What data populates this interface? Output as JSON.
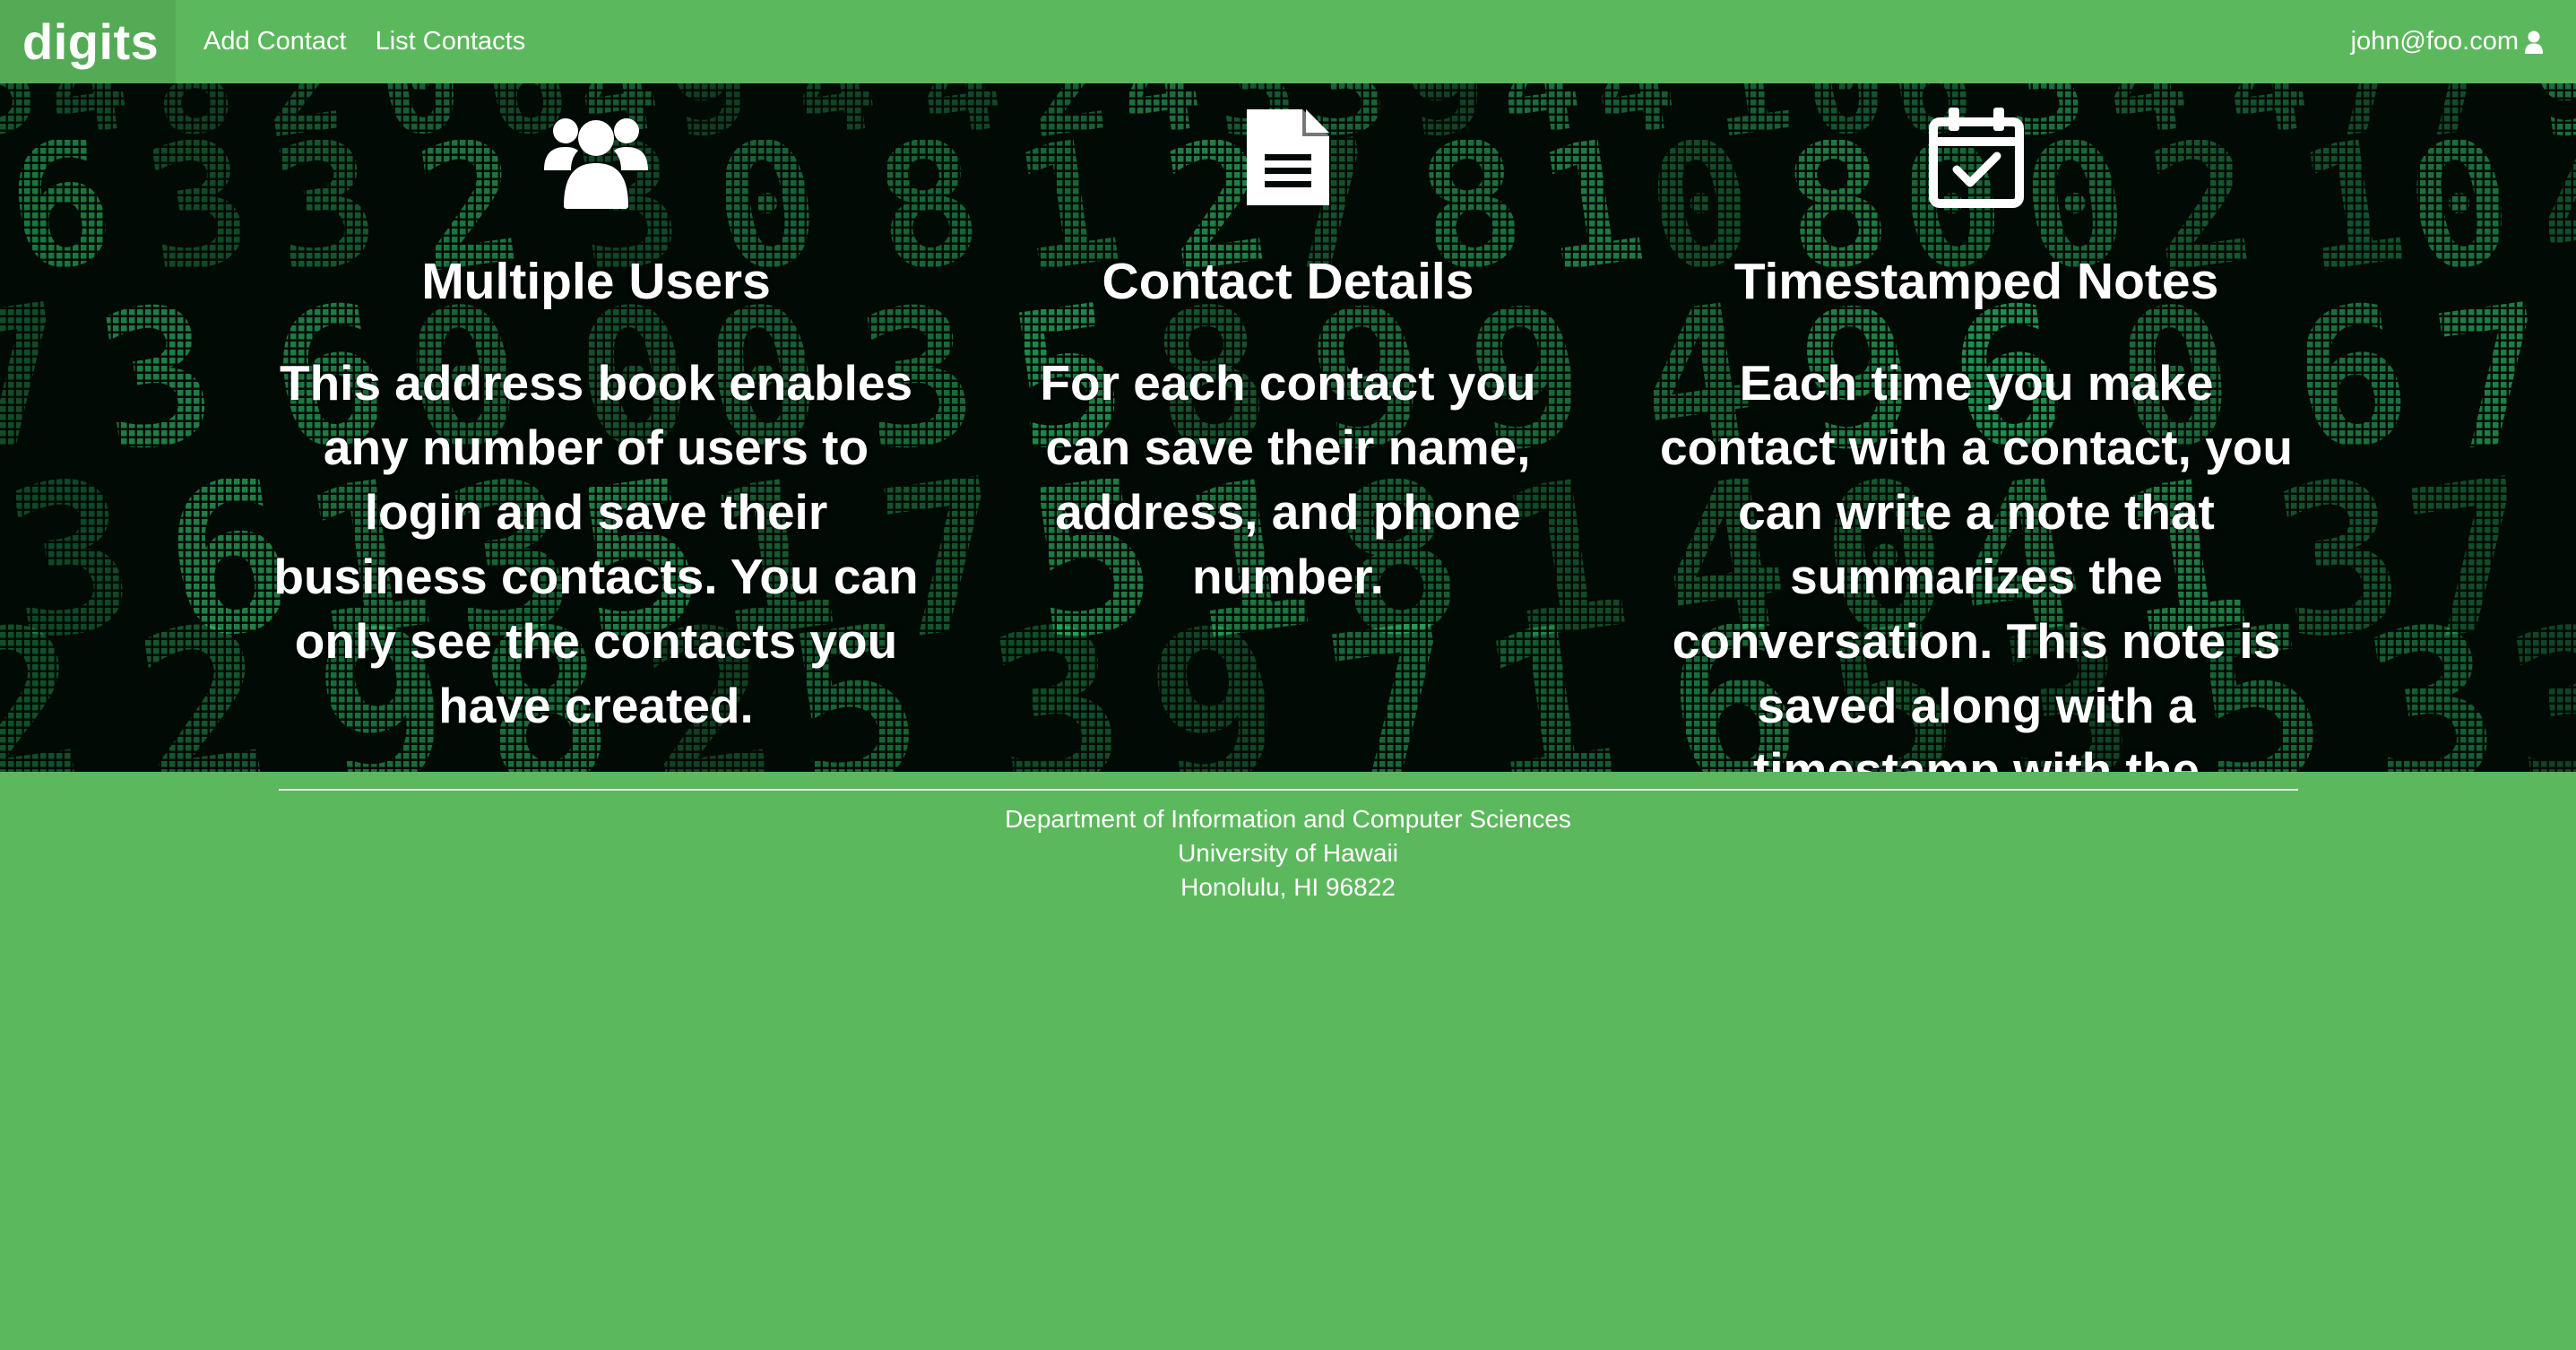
{
  "navbar": {
    "brand": "digits",
    "links": [
      "Add Contact",
      "List Contacts"
    ],
    "user": "john@foo.com",
    "user_icon": "user-icon"
  },
  "features": [
    {
      "icon": "users-icon",
      "title": "Multiple Users",
      "text": "This address book enables any number of users to login and save their business contacts. You can only see the contacts you have created."
    },
    {
      "icon": "document-icon",
      "title": "Contact Details",
      "text": "For each contact you can save their name, address, and phone number."
    },
    {
      "icon": "calendar-check-icon",
      "title": "Timestamped Notes",
      "text": "Each time you make contact with a contact, you can write a note that summarizes the conversation. This note is saved along with a timestamp with the contact."
    }
  ],
  "footer": {
    "lines": [
      "Department of Information and Computer Sciences",
      "University of Hawaii",
      "Honolulu, HI 96822"
    ]
  },
  "colors": {
    "brand_green": "#5cb85c",
    "brand_dark_green": "#55ab55",
    "hero_background": "#020a05",
    "matrix_green": "#3cff8c"
  }
}
